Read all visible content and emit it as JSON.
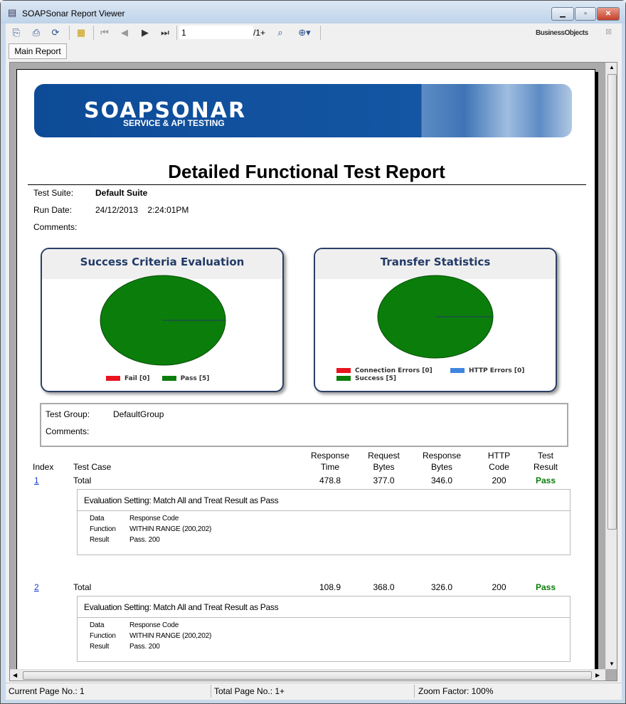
{
  "window": {
    "title": "SOAPSonar Report Viewer",
    "controls": [
      "minimize",
      "maximize",
      "close"
    ]
  },
  "toolbar": {
    "page_value": "1",
    "page_total": "/1+",
    "brand": "BusinessObjects",
    "icons": [
      "export-icon",
      "print-icon",
      "refresh-icon",
      "group-tree-icon",
      "first-page-icon",
      "prev-page-icon",
      "next-page-icon",
      "last-page-icon",
      "find-icon",
      "zoom-icon",
      "close-icon"
    ]
  },
  "tabs": [
    {
      "label": "Main Report"
    }
  ],
  "report": {
    "banner": {
      "logo": "SOAPSONAR",
      "tagline": "SERVICE & API TESTING"
    },
    "title": "Detailed Functional Test Report",
    "suite_label": "Test Suite:",
    "suite_value": "Default Suite",
    "run_date_label": "Run Date:",
    "run_date_value": "24/12/2013    2:24:01PM",
    "comments_label": "Comments:",
    "charts": [
      {
        "title": "Success Criteria Evaluation",
        "legend": [
          {
            "label": "Fail [0]",
            "color": "#e8141e"
          },
          {
            "label": "Pass [5]",
            "color": "#0b7d0b"
          }
        ]
      },
      {
        "title": "Transfer Statistics",
        "legend": [
          {
            "label": "Connection Errors [0]",
            "color": "#e8141e"
          },
          {
            "label": "HTTP Errors [0]",
            "color": "#3f86e0"
          },
          {
            "label": "Success [5]",
            "color": "#0b7d0b"
          }
        ]
      }
    ],
    "group_label": "Test Group:",
    "group_value": "DefaultGroup",
    "group_comments_label": "Comments:",
    "columns": {
      "index": "Index",
      "test_case": "Test Case",
      "response_time": "Response\nTime",
      "request_bytes": "Request\nBytes",
      "response_bytes": "Response\nBytes",
      "http_code": "HTTP\nCode",
      "test_result": "Test\nResult"
    },
    "rows": [
      {
        "index": "1",
        "test_case": "Total",
        "response_time": "478.8",
        "request_bytes": "377.0",
        "response_bytes": "346.0",
        "http_code": "200",
        "result": "Pass",
        "eval": {
          "heading": "Evaluation Setting:  Match All and Treat Result as Pass",
          "data_label": "Data",
          "data": "Response Code",
          "function_label": "Function",
          "function": "WITHIN RANGE (200,202)",
          "result_label": "Result",
          "result": "Pass. 200"
        }
      },
      {
        "index": "2",
        "test_case": "Total",
        "response_time": "108.9",
        "request_bytes": "368.0",
        "response_bytes": "326.0",
        "http_code": "200",
        "result": "Pass",
        "eval": {
          "heading": "Evaluation Setting:  Match All and Treat Result as Pass",
          "data_label": "Data",
          "data": "Response Code",
          "function_label": "Function",
          "function": "WITHIN RANGE (200,202)",
          "result_label": "Result",
          "result": "Pass. 200"
        }
      }
    ]
  },
  "status": {
    "current_page": "Current Page No.: 1",
    "total_page": "Total Page No.: 1+",
    "zoom": "Zoom Factor: 100%"
  },
  "colors": {
    "pass": "#0b7d0b",
    "link": "#1a3fcc",
    "banner": "#1456a3"
  }
}
